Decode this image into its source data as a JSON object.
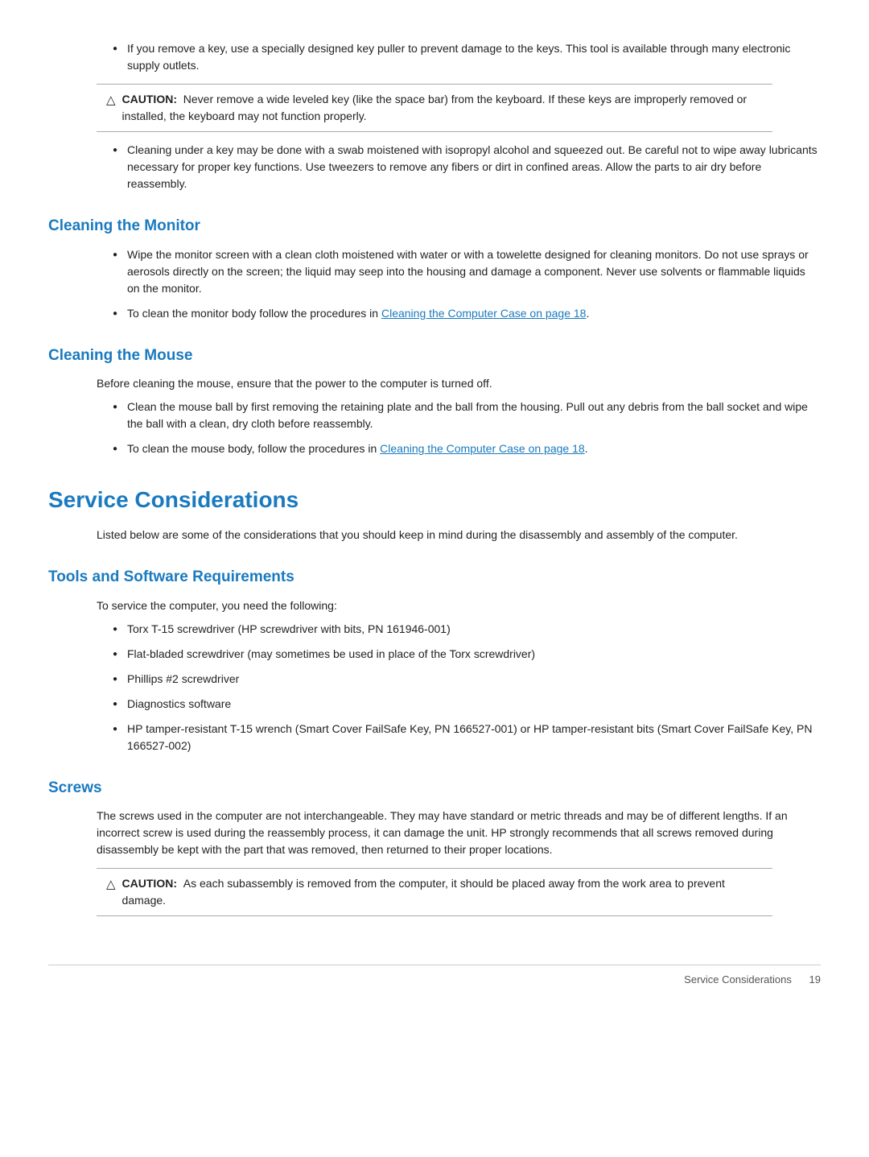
{
  "intro_bullets": [
    "If you remove a key, use a specially designed key puller to prevent damage to the keys. This tool is available through many electronic supply outlets.",
    "Cleaning under a key may be done with a swab moistened with isopropyl alcohol and squeezed out. Be careful not to wipe away lubricants necessary for proper key functions. Use tweezers to remove any fibers or dirt in confined areas. Allow the parts to air dry before reassembly."
  ],
  "caution1": {
    "label": "CAUTION:",
    "text": "Never remove a wide leveled key (like the space bar) from the keyboard. If these keys are improperly removed or installed, the keyboard may not function properly."
  },
  "cleaning_monitor": {
    "heading": "Cleaning the Monitor",
    "bullets": [
      "Wipe the monitor screen with a clean cloth moistened with water or with a towelette designed for cleaning monitors. Do not use sprays or aerosols directly on the screen; the liquid may seep into the housing and damage a component. Never use solvents or flammable liquids on the monitor.",
      "To clean the monitor body follow the procedures in"
    ],
    "link_text": "Cleaning the Computer Case on page 18",
    "link_href": "#"
  },
  "cleaning_mouse": {
    "heading": "Cleaning the Mouse",
    "intro": "Before cleaning the mouse, ensure that the power to the computer is turned off.",
    "bullets": [
      "Clean the mouse ball by first removing the retaining plate and the ball from the housing. Pull out any debris from the ball socket and wipe the ball with a clean, dry cloth before reassembly.",
      "To clean the mouse body, follow the procedures in"
    ],
    "link_text": "Cleaning the Computer Case on page 18",
    "link_href": "#"
  },
  "service_considerations": {
    "heading": "Service Considerations",
    "intro": "Listed below are some of the considerations that you should keep in mind during the disassembly and assembly of the computer."
  },
  "tools_software": {
    "heading": "Tools and Software Requirements",
    "intro": "To service the computer, you need the following:",
    "bullets": [
      "Torx T-15 screwdriver (HP screwdriver with bits, PN 161946-001)",
      "Flat-bladed screwdriver (may sometimes be used in place of the Torx screwdriver)",
      "Phillips #2 screwdriver",
      "Diagnostics software",
      "HP tamper-resistant T-15 wrench (Smart Cover FailSafe Key, PN 166527-001) or HP tamper-resistant bits (Smart Cover FailSafe Key, PN 166527-002)"
    ]
  },
  "screws": {
    "heading": "Screws",
    "body": "The screws used in the computer are not interchangeable. They may have standard or metric threads and may be of different lengths. If an incorrect screw is used during the reassembly process, it can damage the unit. HP strongly recommends that all screws removed during disassembly be kept with the part that was removed, then returned to their proper locations."
  },
  "caution2": {
    "label": "CAUTION:",
    "text": "As each subassembly is removed from the computer, it should be placed away from the work area to prevent damage."
  },
  "footer": {
    "text": "Service Considerations",
    "page": "19"
  }
}
